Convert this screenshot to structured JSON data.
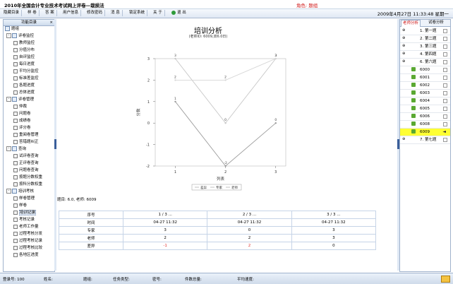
{
  "window": {
    "title": "2010年全国会计专业技术考试网上评卷—栽损法",
    "role": "角色: 题组"
  },
  "toolbar": {
    "buttons": [
      "隐藏目录",
      "样 卷",
      "答 案",
      "用户信息",
      "修改密码",
      "消 息",
      "锁定系统",
      "关 于"
    ],
    "exit": "退 出",
    "datetime": "2009年4月27日 11:33:48 星期一"
  },
  "left_panel": {
    "title": "功能目录",
    "close": "×",
    "tree": [
      {
        "label": "题组",
        "level": 0
      },
      {
        "label": "评卷监控",
        "level": 1
      },
      {
        "label": "教师监控",
        "level": 2
      },
      {
        "label": "分值分布",
        "level": 2
      },
      {
        "label": "自评监控",
        "level": 2
      },
      {
        "label": "每日进度",
        "level": 2
      },
      {
        "label": "平均分监控",
        "level": 2
      },
      {
        "label": "标准差监控",
        "level": 2
      },
      {
        "label": "各题进度",
        "level": 2
      },
      {
        "label": "总体进度",
        "level": 2
      },
      {
        "label": "评卷管理",
        "level": 1
      },
      {
        "label": "仲裁",
        "level": 2
      },
      {
        "label": "问题卷",
        "level": 2
      },
      {
        "label": "成绩卷",
        "level": 2
      },
      {
        "label": "评分卷",
        "level": 2
      },
      {
        "label": "重阅卷管理",
        "level": 2
      },
      {
        "label": "答错题纠正",
        "level": 2
      },
      {
        "label": "查询",
        "level": 1
      },
      {
        "label": "试评卷查询",
        "level": 2
      },
      {
        "label": "正评卷查询",
        "level": 2
      },
      {
        "label": "问题卷查询",
        "level": 2
      },
      {
        "label": "按题分数权重",
        "level": 2
      },
      {
        "label": "按科分数权重",
        "level": 2
      },
      {
        "label": "培训考核",
        "level": 1
      },
      {
        "label": "样卷管理",
        "level": 2
      },
      {
        "label": "样卷",
        "level": 2
      },
      {
        "label": "培训记录",
        "level": 2,
        "selected": true
      },
      {
        "label": "考核记录",
        "level": 2
      },
      {
        "label": "老师工作量",
        "level": 2
      },
      {
        "label": "过程考核分发",
        "level": 2
      },
      {
        "label": "过程考核记录",
        "level": 2
      },
      {
        "label": "过程考核比较",
        "level": 2
      },
      {
        "label": "各地区进度",
        "level": 2
      }
    ]
  },
  "chart": {
    "title": "培训分析",
    "subtitle": "(老师ID: 6009,双6.0日)",
    "xlabel": "列表",
    "ylabel": "分数",
    "legend": [
      "差异",
      "专家",
      "老师"
    ]
  },
  "chart_data": {
    "type": "line",
    "x": [
      1,
      2,
      3
    ],
    "ylim": [
      -2,
      3
    ],
    "yticks": [
      -2,
      -1,
      0,
      1,
      2,
      3
    ],
    "xticks": [
      "1",
      "2",
      "3"
    ],
    "series": [
      {
        "name": "专家",
        "values": [
          3,
          0,
          3
        ],
        "color": "#c8c8c8"
      },
      {
        "name": "老师",
        "values": [
          2,
          2,
          3
        ],
        "color": "#d6d6d6"
      },
      {
        "name": "差异",
        "values": [
          1,
          -2,
          0
        ],
        "color": "#9b9b9b"
      }
    ],
    "point_labels": [
      {
        "series": 0,
        "labels": [
          "3",
          "0",
          "3"
        ]
      },
      {
        "series": 1,
        "labels": [
          "2",
          "2",
          "3"
        ]
      },
      {
        "series": 2,
        "labels": [
          "1",
          "-2",
          "0"
        ]
      }
    ]
  },
  "caption": "题目: 6.0, 老师: 6009",
  "table": {
    "rows": [
      {
        "label": "序号",
        "cells": [
          "1 / 3 ...",
          "2 / 3 ...",
          "3 / 3 ..."
        ]
      },
      {
        "label": "时间",
        "cells": [
          "04-27 11:32",
          "04-27 11:32",
          "04-27 11:32"
        ]
      },
      {
        "label": "专家",
        "cells": [
          "3",
          "0",
          "3"
        ]
      },
      {
        "label": "老师",
        "cells": [
          "2",
          "2",
          "3"
        ]
      },
      {
        "label": "差异",
        "cells": [
          "-1",
          "2",
          "0"
        ],
        "red": [
          true,
          true,
          false
        ]
      }
    ]
  },
  "right_panel": {
    "tabs": [
      "老师分析",
      "试卷分析"
    ],
    "items": [
      {
        "label": "1. 第一题",
        "sub": false
      },
      {
        "label": "2. 第二题",
        "sub": false
      },
      {
        "label": "3. 第三题",
        "sub": false
      },
      {
        "label": "4. 第四题",
        "sub": false
      },
      {
        "label": "6. 第六题",
        "sub": false
      },
      {
        "label": "6000",
        "sub": true
      },
      {
        "label": "6001",
        "sub": true
      },
      {
        "label": "6002",
        "sub": true
      },
      {
        "label": "6003",
        "sub": true
      },
      {
        "label": "6004",
        "sub": true
      },
      {
        "label": "6005",
        "sub": true
      },
      {
        "label": "6006",
        "sub": true
      },
      {
        "label": "6008",
        "sub": true
      },
      {
        "label": "6009",
        "sub": true,
        "selected": true
      },
      {
        "label": "7. 第七题",
        "sub": false
      }
    ]
  },
  "statusbar": {
    "login": "登录号: 100",
    "name": "姓名:",
    "group": "题组:",
    "task": "任务类型:",
    "password": "密号:",
    "count": "件数总量:",
    "avg": "平均速度:"
  }
}
